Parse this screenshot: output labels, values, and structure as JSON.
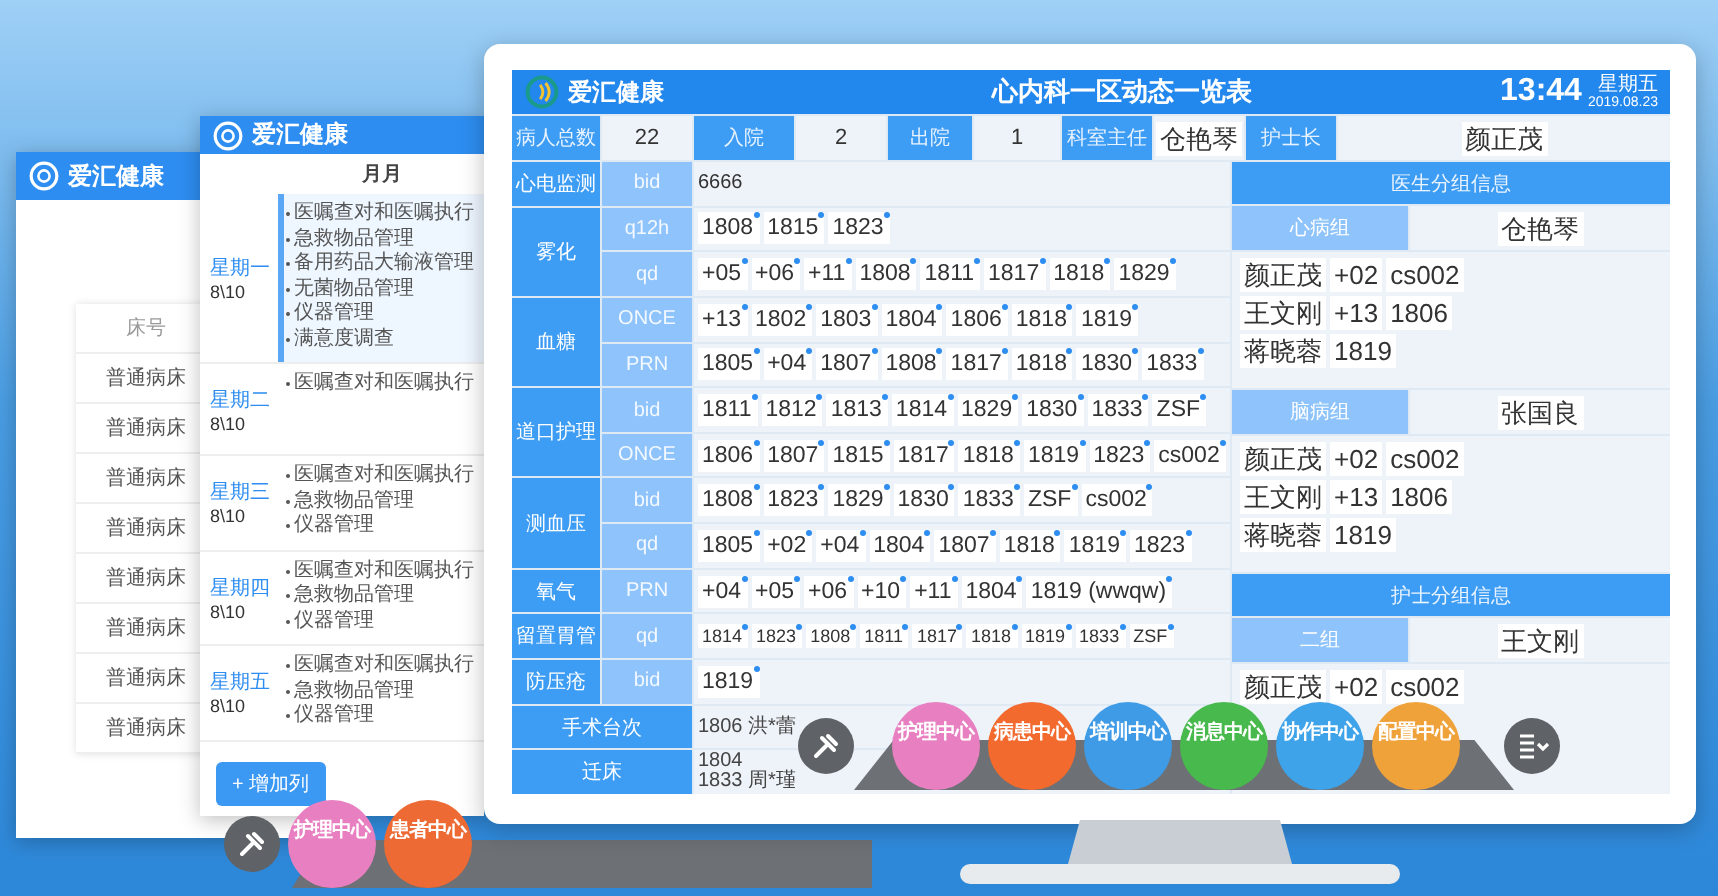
{
  "back_window": {
    "logo": "爱汇健康",
    "column_header": "床号",
    "rows": [
      "普通病床",
      "普通病床",
      "普通病床",
      "普通病床",
      "普通病床",
      "普通病床",
      "普通病床",
      "普通病床"
    ]
  },
  "middle_window": {
    "logo": "爱汇健康",
    "column_header": "月月",
    "days": [
      {
        "day": "星期一",
        "date": "8\\10",
        "selected": true,
        "tasks": [
          "医嘱查对和医嘱执行",
          "急救物品管理",
          "备用药品大输液管理",
          "无菌物品管理",
          "仪器管理",
          "满意度调查"
        ]
      },
      {
        "day": "星期二",
        "date": "8\\10",
        "selected": false,
        "tasks": [
          "医嘱查对和医嘱执行"
        ]
      },
      {
        "day": "星期三",
        "date": "8\\10",
        "selected": false,
        "tasks": [
          "医嘱查对和医嘱执行",
          "急救物品管理",
          "仪器管理"
        ]
      },
      {
        "day": "星期四",
        "date": "8\\10",
        "selected": false,
        "tasks": [
          "医嘱查对和医嘱执行",
          "急救物品管理",
          "仪器管理"
        ]
      },
      {
        "day": "星期五",
        "date": "8\\10",
        "selected": false,
        "tasks": [
          "医嘱查对和医嘱执行",
          "急救物品管理",
          "仪器管理"
        ]
      }
    ],
    "add_button": "+ 增加列"
  },
  "back_dock": {
    "apps": [
      {
        "label": "护理中心",
        "color": "#e77fc0"
      },
      {
        "label": "患者中心",
        "color": "#ee6a35"
      }
    ]
  },
  "main_screen": {
    "logo": "爱汇健康",
    "title": "心内科一区动态一览表",
    "time": "13:44",
    "weekday": "星期五",
    "date": "2019.08.23",
    "summary": [
      {
        "label": "病人总数",
        "value": "22"
      },
      {
        "label": "入院",
        "value": "2"
      },
      {
        "label": "出院",
        "value": "1"
      },
      {
        "label": "科室主任",
        "value": "仓艳琴"
      },
      {
        "label": "护士长",
        "value": "颜正茂"
      }
    ],
    "care_table": [
      {
        "category": "心电监测",
        "entries": [
          {
            "frequency": "bid",
            "kind": "text",
            "items": [
              "6666"
            ]
          }
        ]
      },
      {
        "category": "雾化",
        "entries": [
          {
            "frequency": "q12h",
            "kind": "tags",
            "items": [
              "1808",
              "1815",
              "1823"
            ]
          },
          {
            "frequency": "qd",
            "kind": "tags",
            "items": [
              "+05",
              "+06",
              "+11",
              "1808",
              "1811",
              "1817",
              "1818",
              "1829"
            ]
          }
        ]
      },
      {
        "category": "血糖",
        "entries": [
          {
            "frequency": "ONCE",
            "kind": "tags",
            "items": [
              "+13",
              "1802",
              "1803",
              "1804",
              "1806",
              "1818",
              "1819"
            ]
          },
          {
            "frequency": "PRN",
            "kind": "tags",
            "items": [
              "1805",
              "+04",
              "1807",
              "1808",
              "1817",
              "1818",
              "1830",
              "1833"
            ]
          }
        ]
      },
      {
        "category": "道口护理",
        "entries": [
          {
            "frequency": "bid",
            "kind": "tags",
            "items": [
              "1811",
              "1812",
              "1813",
              "1814",
              "1829",
              "1830",
              "1833",
              "ZSF"
            ]
          },
          {
            "frequency": "ONCE",
            "kind": "tags",
            "items": [
              "1806",
              "1807",
              "1815",
              "1817",
              "1818",
              "1819",
              "1823",
              "cs002"
            ]
          }
        ]
      },
      {
        "category": "测血压",
        "entries": [
          {
            "frequency": "bid",
            "kind": "tags",
            "items": [
              "1808",
              "1823",
              "1829",
              "1830",
              "1833",
              "ZSF",
              "cs002"
            ]
          },
          {
            "frequency": "qd",
            "kind": "tags",
            "items": [
              "1805",
              "+02",
              "+04",
              "1804",
              "1807",
              "1818",
              "1819",
              "1823"
            ]
          }
        ]
      },
      {
        "category": "氧气",
        "entries": [
          {
            "frequency": "PRN",
            "kind": "tags",
            "items": [
              "+04",
              "+05",
              "+06",
              "+10",
              "+11",
              "1804",
              "1819 (wwqw)"
            ]
          }
        ]
      },
      {
        "category": "留置胃管",
        "entries": [
          {
            "frequency": "qd",
            "kind": "small_tags",
            "items": [
              "1814",
              "1823",
              "1808",
              "1811",
              "1817",
              "1818",
              "1819",
              "1833",
              "ZSF"
            ]
          }
        ]
      },
      {
        "category": "防压疮",
        "entries": [
          {
            "frequency": "bid",
            "kind": "tags",
            "items": [
              "1819"
            ]
          }
        ]
      },
      {
        "category": "手术台次",
        "entries": [
          {
            "kind": "names",
            "items": [
              "1806 洪*蕾"
            ]
          }
        ]
      },
      {
        "category": "迁床",
        "entries": [
          {
            "kind": "names",
            "items": [
              "1804",
              "1833 周*瑾"
            ]
          }
        ]
      }
    ],
    "doctor_groups": {
      "title": "医生分组信息",
      "groups": [
        {
          "name": "心病组",
          "leader": "仓艳琴",
          "members": [
            [
              "颜正茂",
              "+02",
              "cs002"
            ],
            [
              "王文刚",
              "+13",
              "1806"
            ],
            [
              "蒋晓蓉",
              "1819"
            ]
          ]
        },
        {
          "name": "脑病组",
          "leader": "张国良",
          "members": [
            [
              "颜正茂",
              "+02",
              "cs002"
            ],
            [
              "王文刚",
              "+13",
              "1806"
            ],
            [
              "蒋晓蓉",
              "1819"
            ]
          ]
        }
      ]
    },
    "nurse_groups": {
      "title": "护士分组信息",
      "groups": [
        {
          "name": "二组",
          "leader": "王文刚",
          "members": [
            [
              "颜正茂",
              "+02",
              "cs002"
            ]
          ]
        }
      ]
    },
    "dock": {
      "apps": [
        {
          "label": "护理中心",
          "color": "#e77fc0"
        },
        {
          "label": "病患中心",
          "color": "#f26a2e"
        },
        {
          "label": "培训中心",
          "color": "#3f9be6"
        },
        {
          "label": "消息中心",
          "color": "#48b94c"
        },
        {
          "label": "协作中心",
          "color": "#3fa3ea"
        },
        {
          "label": "配置中心",
          "color": "#f0a23a"
        }
      ]
    }
  }
}
